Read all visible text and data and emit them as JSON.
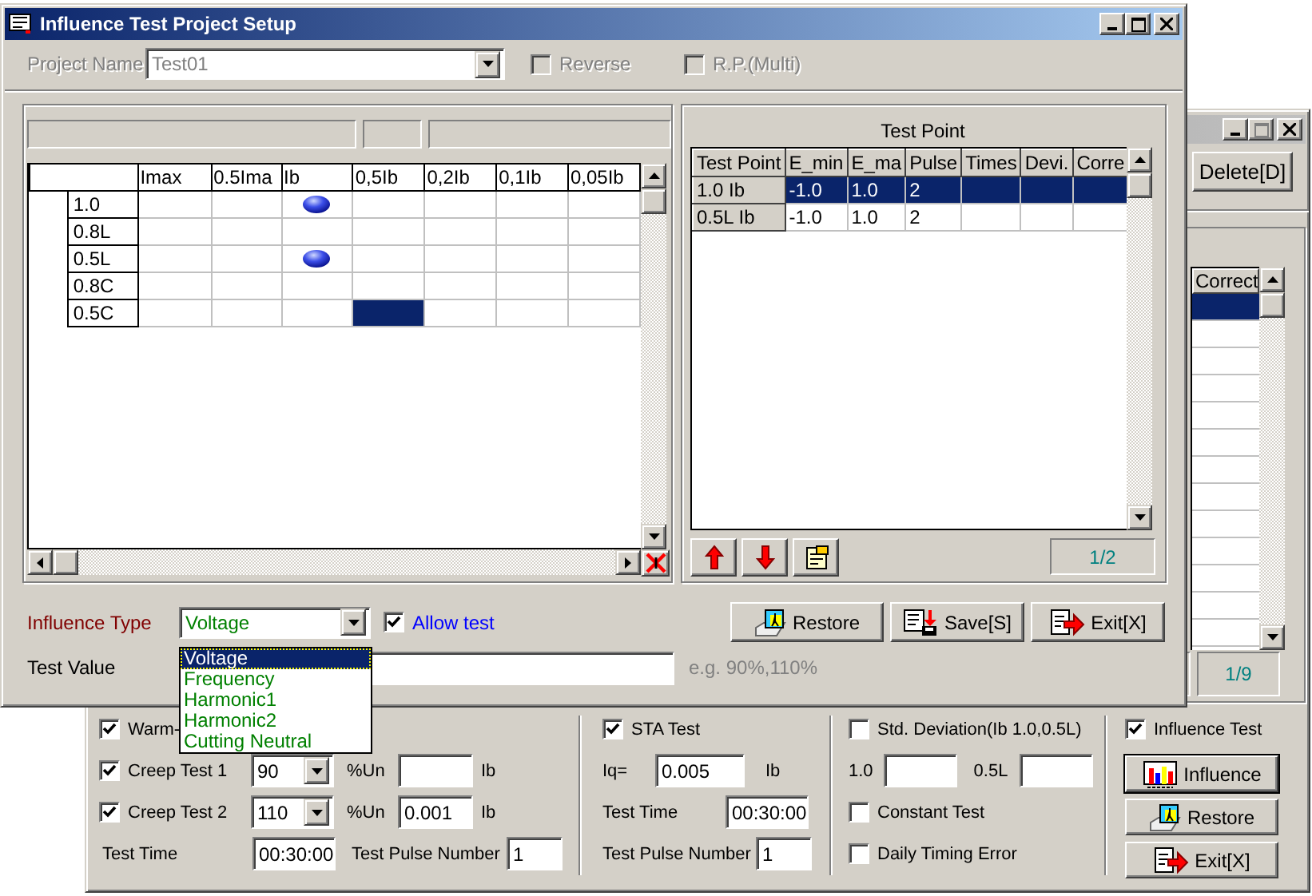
{
  "back_window": {
    "delete_button": "Delete[D]",
    "table": {
      "columns": [
        "Correct"
      ],
      "rows": [
        {
          "selected": true
        },
        {
          "selected": false
        },
        {
          "selected": false
        },
        {
          "selected": false
        },
        {
          "selected": false
        },
        {
          "selected": false
        },
        {
          "selected": false
        },
        {
          "selected": false
        },
        {
          "selected": false
        },
        {
          "selected": false
        },
        {
          "selected": false
        },
        {
          "selected": false
        },
        {
          "selected": false
        }
      ]
    },
    "counter": "1/9",
    "warm_up": {
      "label": "Warm-",
      "checked": true
    },
    "creep_tests": [
      {
        "label": "Creep Test 1",
        "checked": true,
        "voltage": "90",
        "unit": "%Un",
        "current_unit": "Ib"
      },
      {
        "label": "Creep Test 2",
        "checked": true,
        "voltage": "110",
        "unit": "%Un",
        "current": "0.001",
        "current_unit": "Ib"
      }
    ],
    "test_time": {
      "label": "Test Time",
      "value": "00:30:00"
    },
    "pulse": {
      "label": "Test Pulse Number",
      "value": "1"
    },
    "sta": {
      "label": "STA Test",
      "checked": true,
      "iq_label": "Iq=",
      "iq": "0.005",
      "iq_unit": "Ib",
      "time_label": "Test Time",
      "time": "00:30:00",
      "pulse_label": "Test Pulse Number",
      "pulse": "1"
    },
    "std_dev": {
      "label": "Std. Deviation(Ib 1.0,0.5L)",
      "checked": false,
      "fields": [
        {
          "label": "1.0"
        },
        {
          "label": "0.5L"
        }
      ]
    },
    "checks": [
      {
        "label": "Constant Test",
        "checked": false
      },
      {
        "label": "Daily Timing Error",
        "checked": false
      }
    ],
    "influence_test": {
      "label": "Influence Test",
      "checked": true
    },
    "buttons": [
      {
        "label": "Influence",
        "kind": "influence",
        "default": true
      },
      {
        "label": "Restore",
        "kind": "restore",
        "default": false
      },
      {
        "label": "Exit[X]",
        "kind": "exit",
        "default": false
      }
    ]
  },
  "main_window": {
    "title": "Influence Test Project Setup",
    "project_name": {
      "label": "Project Name",
      "value": "Test01",
      "disabled": true
    },
    "options": [
      {
        "label": "Reverse",
        "checked": false,
        "disabled": true
      },
      {
        "label": "R.P.(Multi)",
        "checked": false,
        "disabled": true
      }
    ],
    "points_grid": {
      "columns": [
        "Imax",
        "0.5Ima",
        "Ib",
        "0,5Ib",
        "0,2Ib",
        "0,1Ib",
        "0,05Ib"
      ],
      "rows": [
        {
          "label": "1.0",
          "cells": [
            {
              "marked": false,
              "selected": false
            },
            {
              "marked": false,
              "selected": false
            },
            {
              "marked": true,
              "selected": false
            },
            {
              "marked": false,
              "selected": false
            },
            {
              "marked": false,
              "selected": false
            },
            {
              "marked": false,
              "selected": false
            },
            {
              "marked": false,
              "selected": false
            }
          ]
        },
        {
          "label": "0.8L",
          "cells": [
            {
              "marked": false,
              "selected": false
            },
            {
              "marked": false,
              "selected": false
            },
            {
              "marked": false,
              "selected": false
            },
            {
              "marked": false,
              "selected": false
            },
            {
              "marked": false,
              "selected": false
            },
            {
              "marked": false,
              "selected": false
            },
            {
              "marked": false,
              "selected": false
            }
          ]
        },
        {
          "label": "0.5L",
          "cells": [
            {
              "marked": false,
              "selected": false
            },
            {
              "marked": false,
              "selected": false
            },
            {
              "marked": true,
              "selected": false
            },
            {
              "marked": false,
              "selected": false
            },
            {
              "marked": false,
              "selected": false
            },
            {
              "marked": false,
              "selected": false
            },
            {
              "marked": false,
              "selected": false
            }
          ]
        },
        {
          "label": "0.8C",
          "cells": [
            {
              "marked": false,
              "selected": false
            },
            {
              "marked": false,
              "selected": false
            },
            {
              "marked": false,
              "selected": false
            },
            {
              "marked": false,
              "selected": false
            },
            {
              "marked": false,
              "selected": false
            },
            {
              "marked": false,
              "selected": false
            },
            {
              "marked": false,
              "selected": false
            }
          ]
        },
        {
          "label": "0.5C",
          "cells": [
            {
              "marked": false,
              "selected": false
            },
            {
              "marked": false,
              "selected": false
            },
            {
              "marked": false,
              "selected": false
            },
            {
              "marked": false,
              "selected": true
            },
            {
              "marked": false,
              "selected": false
            },
            {
              "marked": false,
              "selected": false
            },
            {
              "marked": false,
              "selected": false
            }
          ]
        }
      ]
    },
    "test_point_panel": {
      "title": "Test Point",
      "columns": [
        "Test Point",
        "E_min",
        "E_ma",
        "Pulse",
        "Times",
        "Devi.",
        "Corre"
      ],
      "rows": [
        {
          "cells": [
            "1.0 Ib",
            "-1.0",
            "1.0",
            "2"
          ],
          "selected": true
        },
        {
          "cells": [
            "0.5L Ib",
            "-1.0",
            "1.0",
            "2"
          ],
          "selected": false
        }
      ],
      "counter": "1/2"
    },
    "buttons": [
      {
        "label": "Restore",
        "kind": "restore"
      },
      {
        "label": "Save[S]",
        "kind": "save"
      },
      {
        "label": "Exit[X]",
        "kind": "exit"
      }
    ],
    "influence_type": {
      "label": "Influence Type",
      "value": "Voltage",
      "options": [
        {
          "label": "Voltage",
          "selected": true
        },
        {
          "label": "Frequency",
          "selected": false
        },
        {
          "label": "Harmonic1",
          "selected": false
        },
        {
          "label": "Harmonic2",
          "selected": false
        },
        {
          "label": "Cutting Neutral",
          "selected": false
        }
      ]
    },
    "allow_test": {
      "label": "Allow test",
      "checked": true
    },
    "test_value": {
      "label": "Test Value",
      "hint": "e.g. 90%,110%"
    }
  }
}
